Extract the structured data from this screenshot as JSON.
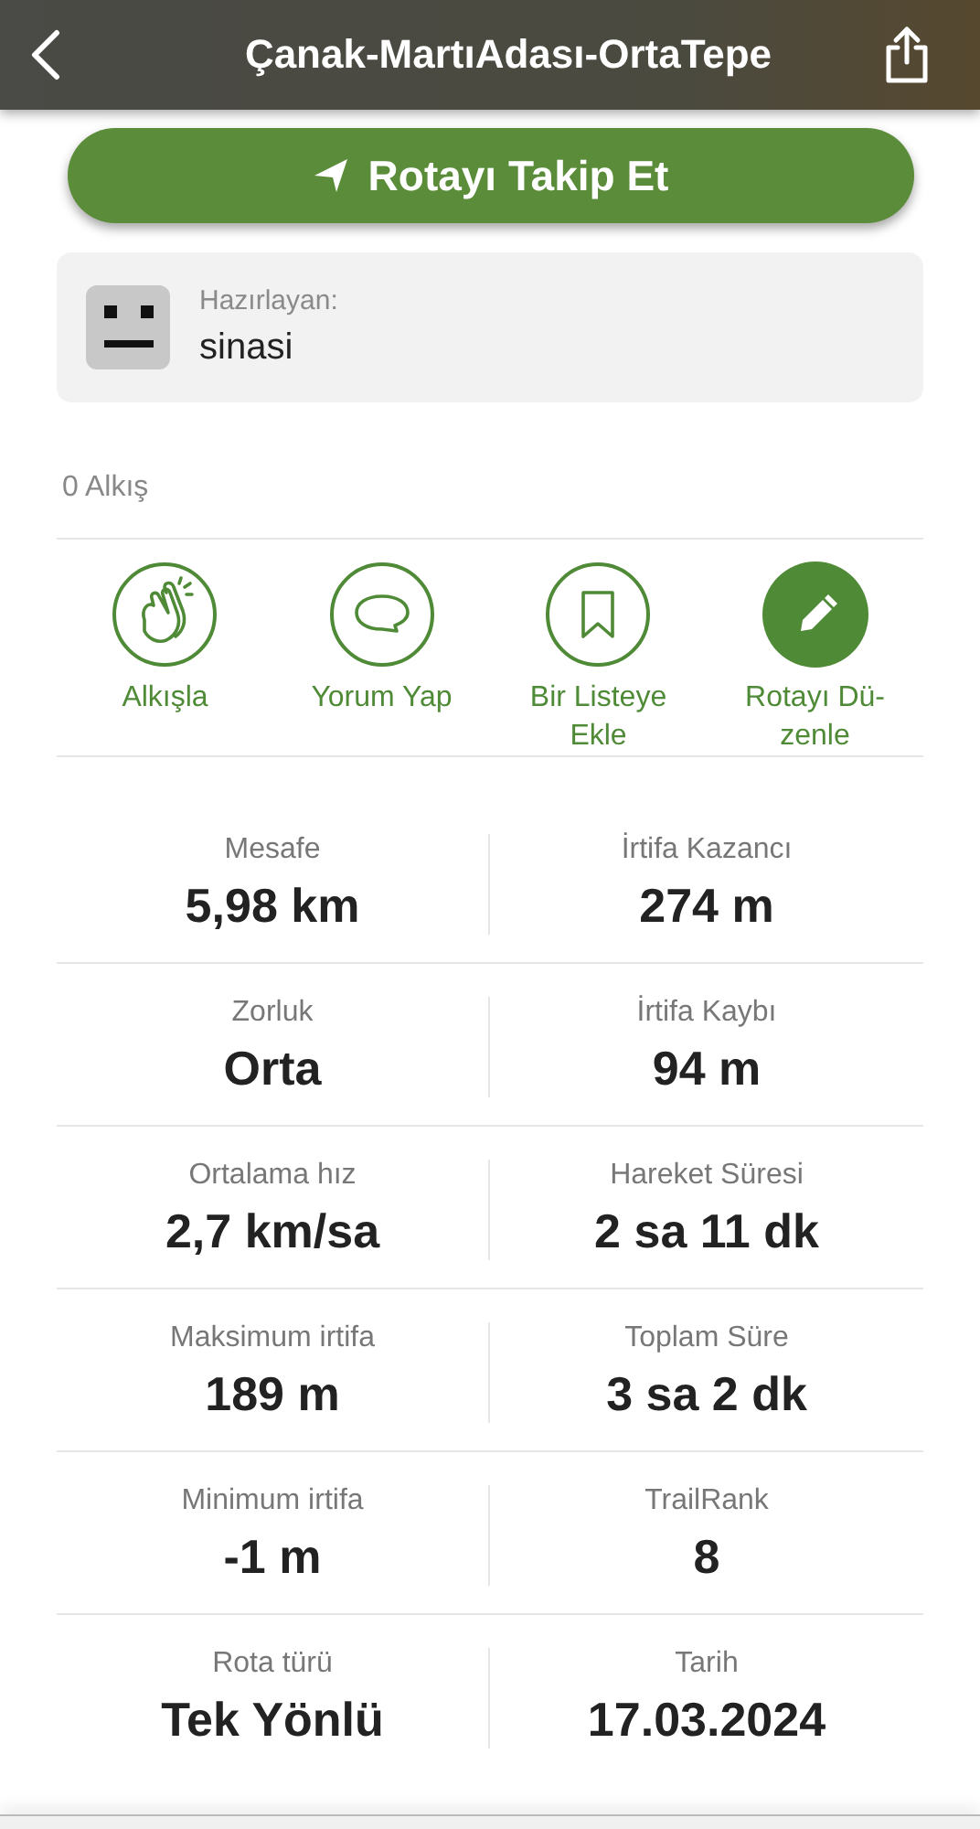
{
  "header": {
    "title": "Çanak-MartıAdası-OrtaTepe"
  },
  "follow_button": {
    "label": "Rotayı Takip Et"
  },
  "author": {
    "caption": "Hazırlayan:",
    "name": "sinasi"
  },
  "applause_count": "0 Alkış",
  "actions": [
    {
      "kind": "clap",
      "label": "Alkışla"
    },
    {
      "kind": "comment",
      "label": "Yorum Yap"
    },
    {
      "kind": "bookmark",
      "label": "Bir Listeye Ekle"
    },
    {
      "kind": "edit",
      "label": "Rotayı Dü-zenle"
    }
  ],
  "stats": [
    {
      "label": "Mesafe",
      "value": "5,98 km"
    },
    {
      "label": "İrtifa Kazancı",
      "value": "274 m"
    },
    {
      "label": "Zorluk",
      "value": "Orta"
    },
    {
      "label": "İrtifa Kaybı",
      "value": "94 m"
    },
    {
      "label": "Ortalama hız",
      "value": "2,7 km/sa"
    },
    {
      "label": "Hareket Süresi",
      "value": "2 sa 11 dk"
    },
    {
      "label": "Maksimum irtifa",
      "value": "189 m"
    },
    {
      "label": "Toplam Süre",
      "value": "3 sa 2 dk"
    },
    {
      "label": "Minimum irtifa",
      "value": "-1 m"
    },
    {
      "label": "TrailRank",
      "value": "8"
    },
    {
      "label": "Rota türü",
      "value": "Tek Yönlü"
    },
    {
      "label": "Tarih",
      "value": "17.03.2024"
    }
  ]
}
